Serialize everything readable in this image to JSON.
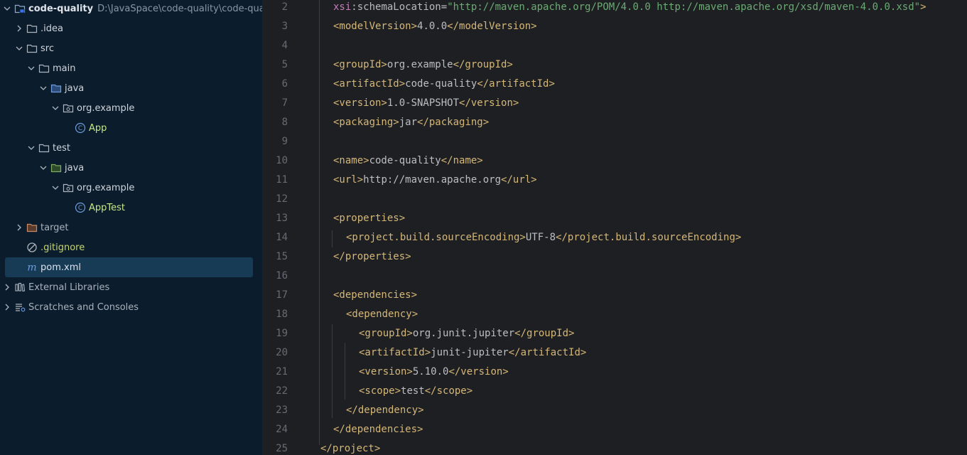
{
  "project_tree": {
    "root": {
      "name": "code-quality",
      "path": "D:\\JavaSpace\\code-quality\\code-quality"
    },
    "items": [
      {
        "label": ".idea"
      },
      {
        "label": "src"
      },
      {
        "label": "main"
      },
      {
        "label": "java"
      },
      {
        "label": "org.example"
      },
      {
        "label": "App"
      },
      {
        "label": "test"
      },
      {
        "label": "java"
      },
      {
        "label": "org.example"
      },
      {
        "label": "AppTest"
      },
      {
        "label": "target"
      },
      {
        "label": ".gitignore"
      },
      {
        "label": "pom.xml"
      },
      {
        "label": "External Libraries"
      },
      {
        "label": "Scratches and Consoles"
      }
    ],
    "selected": "pom.xml"
  },
  "editor": {
    "file": "pom.xml",
    "lines": [
      {
        "n": "2",
        "parts": [
          [
            "ns",
            "xsi"
          ],
          [
            "txt",
            ":"
          ],
          [
            "attr",
            "schemaLocation"
          ],
          [
            "txt",
            "="
          ],
          [
            "str",
            "\"http://maven.apache.org/POM/4.0.0 http://maven.apache.org/xsd/maven-4.0.0.xsd\""
          ],
          [
            "tag",
            ">"
          ]
        ]
      },
      {
        "n": "3",
        "parts": [
          [
            "tag",
            "<modelVersion>"
          ],
          [
            "txt",
            "4.0.0"
          ],
          [
            "tag",
            "</modelVersion>"
          ]
        ]
      },
      {
        "n": "4",
        "parts": []
      },
      {
        "n": "5",
        "parts": [
          [
            "tag",
            "<groupId>"
          ],
          [
            "txt",
            "org.example"
          ],
          [
            "tag",
            "</groupId>"
          ]
        ]
      },
      {
        "n": "6",
        "parts": [
          [
            "tag",
            "<artifactId>"
          ],
          [
            "txt",
            "code-quality"
          ],
          [
            "tag",
            "</artifactId>"
          ]
        ]
      },
      {
        "n": "7",
        "parts": [
          [
            "tag",
            "<version>"
          ],
          [
            "txt",
            "1.0-SNAPSHOT"
          ],
          [
            "tag",
            "</version>"
          ]
        ]
      },
      {
        "n": "8",
        "parts": [
          [
            "tag",
            "<packaging>"
          ],
          [
            "txt",
            "jar"
          ],
          [
            "tag",
            "</packaging>"
          ]
        ]
      },
      {
        "n": "9",
        "parts": []
      },
      {
        "n": "10",
        "parts": [
          [
            "tag",
            "<name>"
          ],
          [
            "txt",
            "code-quality"
          ],
          [
            "tag",
            "</name>"
          ]
        ]
      },
      {
        "n": "11",
        "parts": [
          [
            "tag",
            "<url>"
          ],
          [
            "txt",
            "http://maven.apache.org"
          ],
          [
            "tag",
            "</url>"
          ]
        ]
      },
      {
        "n": "12",
        "parts": []
      },
      {
        "n": "13",
        "parts": [
          [
            "tag",
            "<properties>"
          ]
        ]
      },
      {
        "n": "14",
        "parts": [
          [
            "tag",
            "<project.build.sourceEncoding>"
          ],
          [
            "txt",
            "UTF-8"
          ],
          [
            "tag",
            "</project.build.sourceEncoding>"
          ]
        ]
      },
      {
        "n": "15",
        "parts": [
          [
            "tag",
            "</properties>"
          ]
        ]
      },
      {
        "n": "16",
        "parts": []
      },
      {
        "n": "17",
        "parts": [
          [
            "tag",
            "<dependencies>"
          ]
        ]
      },
      {
        "n": "18",
        "parts": [
          [
            "tag",
            "<dependency>"
          ]
        ]
      },
      {
        "n": "19",
        "parts": [
          [
            "tag",
            "<groupId>"
          ],
          [
            "txt",
            "org.junit.jupiter"
          ],
          [
            "tag",
            "</groupId>"
          ]
        ]
      },
      {
        "n": "20",
        "parts": [
          [
            "tag",
            "<artifactId>"
          ],
          [
            "txt",
            "junit-jupiter"
          ],
          [
            "tag",
            "</artifactId>"
          ]
        ]
      },
      {
        "n": "21",
        "parts": [
          [
            "tag",
            "<version>"
          ],
          [
            "txt",
            "5.10.0"
          ],
          [
            "tag",
            "</version>"
          ]
        ]
      },
      {
        "n": "22",
        "parts": [
          [
            "tag",
            "<scope>"
          ],
          [
            "txt",
            "test"
          ],
          [
            "tag",
            "</scope>"
          ]
        ]
      },
      {
        "n": "23",
        "parts": [
          [
            "tag",
            "</dependency>"
          ]
        ]
      },
      {
        "n": "24",
        "parts": [
          [
            "tag",
            "</dependencies>"
          ]
        ]
      },
      {
        "n": "25",
        "parts": [
          [
            "tag",
            "</project>"
          ]
        ]
      }
    ]
  },
  "colors": {
    "panel_bg": "#0b1d2d",
    "editor_bg": "#1e1f22",
    "tag": "#d5b778",
    "string": "#6aab73",
    "namespace": "#c77dbb",
    "selection": "#173a55"
  }
}
